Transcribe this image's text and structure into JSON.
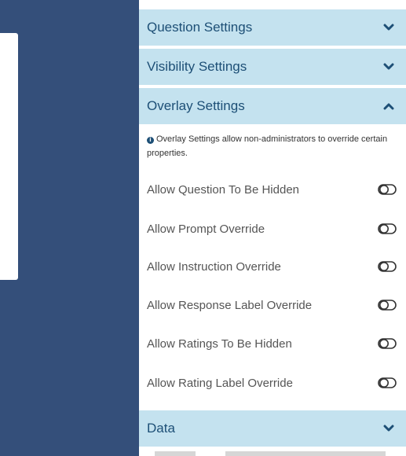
{
  "sections": {
    "question_settings": {
      "label": "Question Settings",
      "expanded": false
    },
    "visibility_settings": {
      "label": "Visibility Settings",
      "expanded": false
    },
    "overlay_settings": {
      "label": "Overlay Settings",
      "expanded": true,
      "info": "Overlay Settings allow non-administrators to override certain properties.",
      "options": [
        {
          "label": "Allow Question To Be Hidden",
          "enabled": false
        },
        {
          "label": "Allow Prompt Override",
          "enabled": false
        },
        {
          "label": "Allow Instruction Override",
          "enabled": false
        },
        {
          "label": "Allow Response Label Override",
          "enabled": false
        },
        {
          "label": "Allow Ratings To Be Hidden",
          "enabled": false
        },
        {
          "label": "Allow Rating Label Override",
          "enabled": false
        }
      ]
    },
    "data": {
      "label": "Data",
      "expanded": false
    }
  },
  "colors": {
    "sidebar": "#344f7a",
    "header_bg": "#c4e2ef",
    "header_text": "#1d4f76",
    "option_text": "#555555"
  },
  "icons": {
    "collapsed": "chevron-down-icon",
    "expanded": "chevron-up-icon",
    "info": "info-circle-icon",
    "toggle": "toggle-off-icon"
  }
}
